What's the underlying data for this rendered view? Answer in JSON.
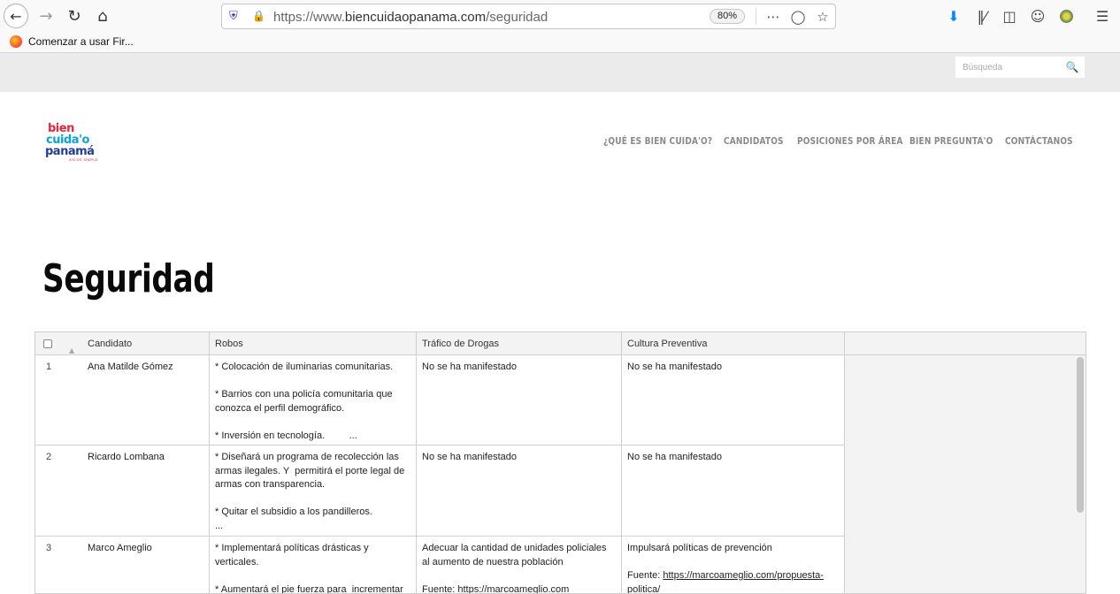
{
  "browser": {
    "back_icon": "arrow-left-icon",
    "forward_icon": "arrow-right-icon",
    "reload_icon": "reload-icon",
    "home_icon": "home-icon",
    "url_scheme": "https://www.",
    "url_host": "biencuidaopanama.com",
    "url_path": "/seguridad",
    "zoom": "80%",
    "bookmark_label": "Comenzar a usar Fir..."
  },
  "site": {
    "search_placeholder": "Búsqueda",
    "logo": {
      "line1": "bien",
      "line2": "cuida'o",
      "line3": "panamá",
      "tagline": "ASÍ DE SIMPLE"
    },
    "nav": [
      "¿QUÉ ES BIEN CUIDA'O?",
      "CANDIDATOS",
      "POSICIONES POR ÁREA",
      "BIEN PREGUNTA'O",
      "CONTÁCTANOS"
    ],
    "page_title": "Seguridad"
  },
  "table": {
    "columns": [
      "Candidato",
      "Robos",
      "Tráfico de Drogas",
      "Cultura Preventiva"
    ],
    "rows": [
      {
        "num": "1",
        "candidato": "Ana Matilde Gómez",
        "robos": [
          "* Colocación de iluminarias comunitarias.",
          "* Barrios con una policía comunitaria que conozca el perfil demográfico.",
          "* Inversión en tecnología.         ..."
        ],
        "trafico": [
          "No se ha manifestado"
        ],
        "cultura": [
          "No se ha manifestado"
        ]
      },
      {
        "num": "2",
        "candidato": "Ricardo Lombana",
        "robos": [
          "* Diseñará un programa de recolección las armas ilegales. Y  permitirá el porte legal de armas con transparencia.",
          "* Quitar el subsidio a los pandilleros.\n..."
        ],
        "trafico": [
          "No se ha manifestado"
        ],
        "cultura": [
          "No se ha manifestado"
        ]
      },
      {
        "num": "3",
        "candidato": "Marco Ameglio",
        "robos": [
          "* Implementará políticas drásticas y verticales.",
          "* Aumentará el pie fuerza para  incrementar la"
        ],
        "trafico": [
          "Adecuar la cantidad de unidades policiales al aumento de nuestra población",
          "Fuente: https://marcoameglio.com"
        ],
        "cultura": [
          "Impulsará políticas de prevención"
        ],
        "cultura_source_label": "Fuente: ",
        "cultura_source_link": "https://marcoameglio.com/propuesta-politica/"
      }
    ]
  }
}
